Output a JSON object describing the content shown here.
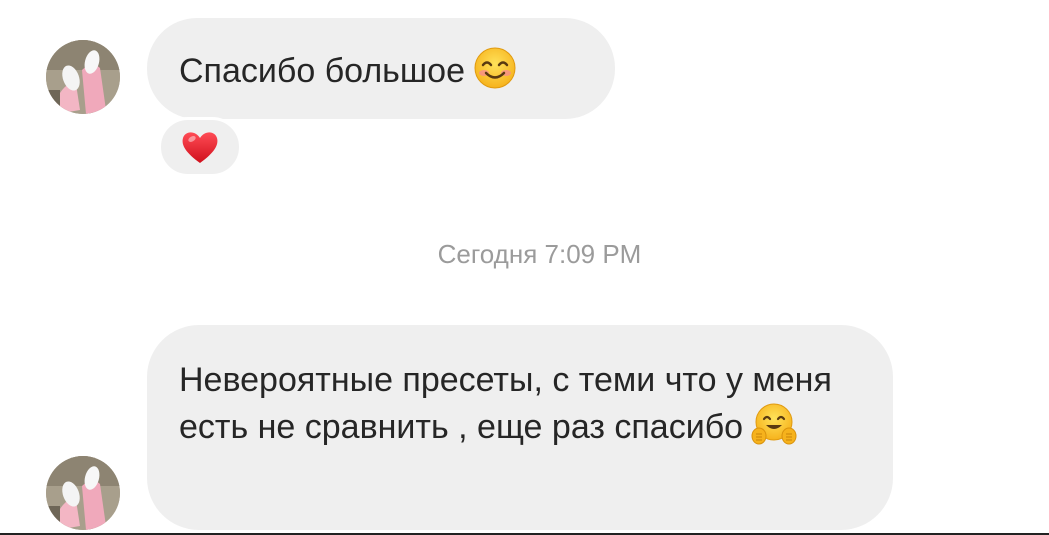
{
  "conversation": {
    "messages": [
      {
        "text": "Спасибо большое",
        "emoji": "smiling-face-with-smiling-eyes"
      },
      {
        "text": "Невероятные пресеты,  с теми что у меня есть не сравнить , еще раз спасибо",
        "emoji": "hugging-face"
      }
    ],
    "reaction": {
      "emoji": "red-heart"
    },
    "timestamp": "Сегодня 7:09 PM"
  },
  "colors": {
    "bubble": "#efefef",
    "text": "#262626",
    "timestamp": "#9b9b9b",
    "heart": "#e8202c"
  }
}
